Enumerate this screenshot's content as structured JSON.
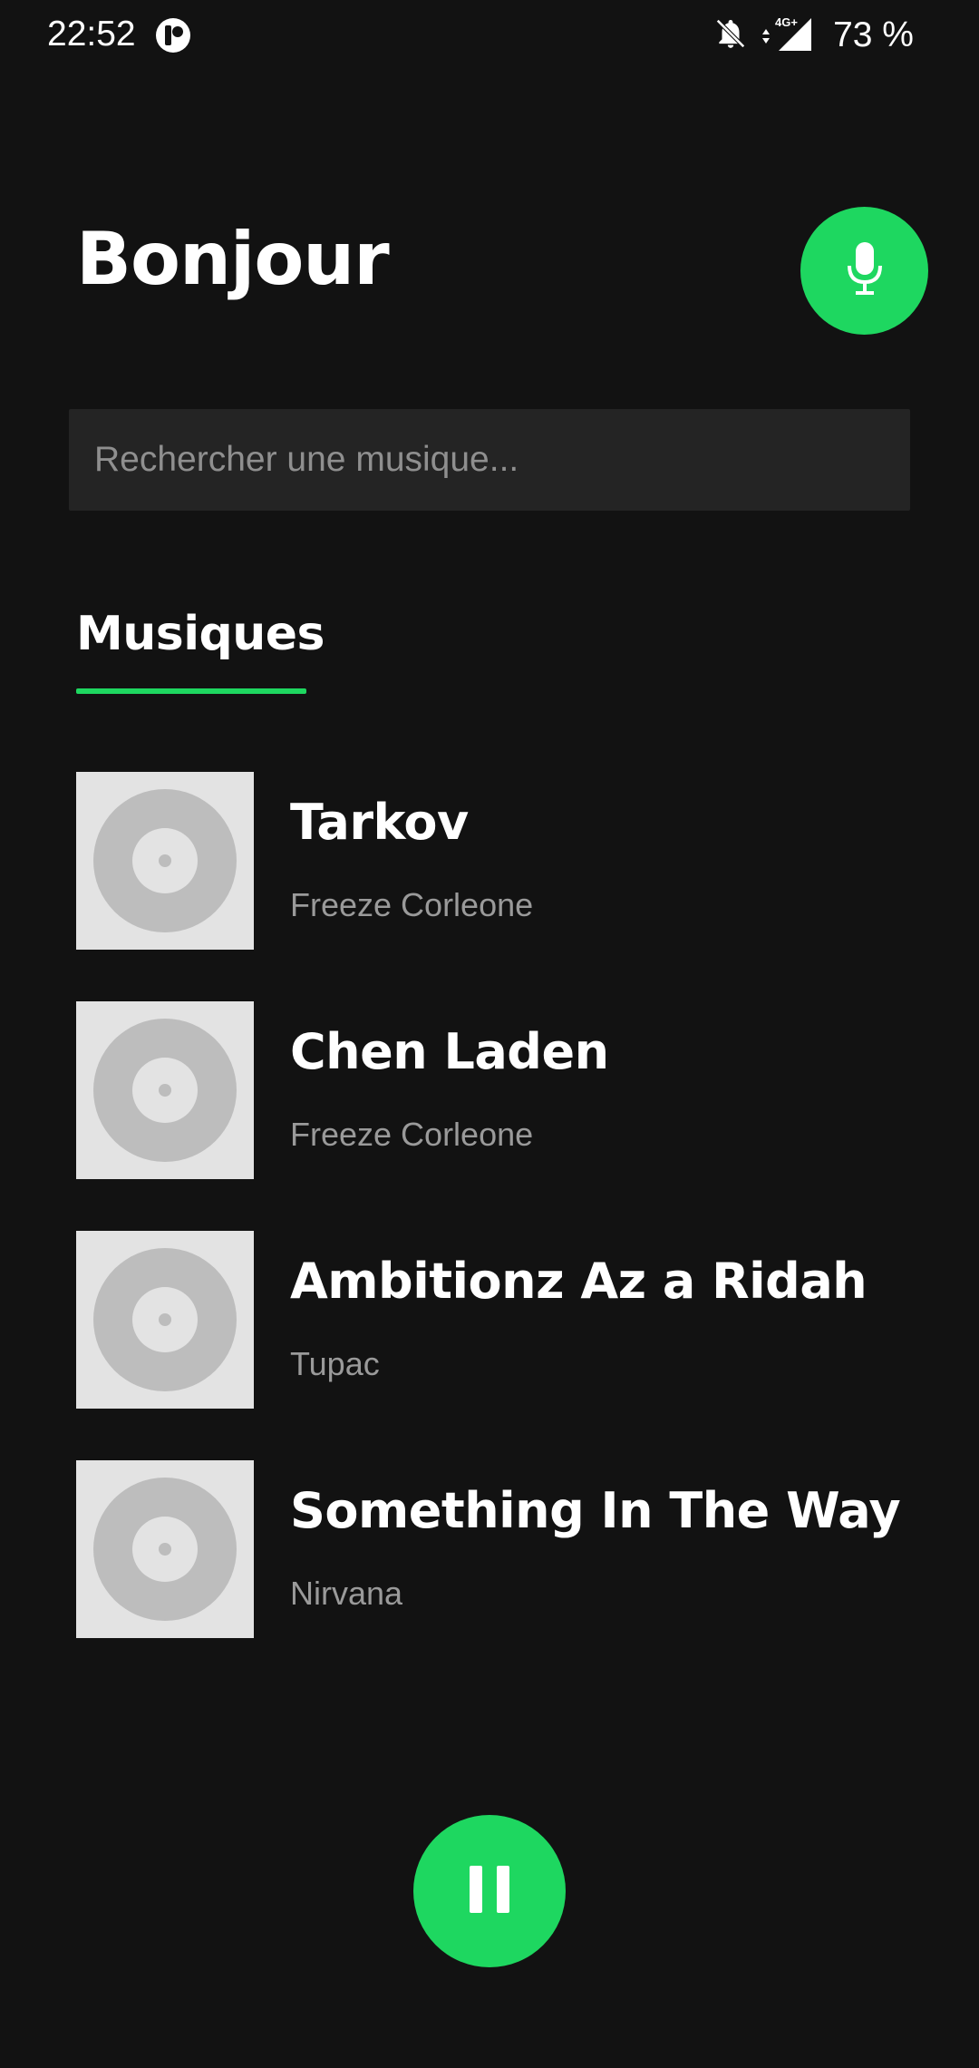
{
  "status_bar": {
    "time": "22:52",
    "battery": "73 %",
    "network": "4G+"
  },
  "header": {
    "greeting": "Bonjour",
    "mic_icon": "microphone-icon"
  },
  "search": {
    "placeholder": "Rechercher une musique...",
    "value": ""
  },
  "section": {
    "title": "Musiques"
  },
  "songs": [
    {
      "title": "Tarkov",
      "artist": "Freeze Corleone"
    },
    {
      "title": "Chen Laden",
      "artist": "Freeze Corleone"
    },
    {
      "title": "Ambitionz Az a Ridah",
      "artist": "Tupac"
    },
    {
      "title": "Something In The Way",
      "artist": "Nirvana"
    }
  ],
  "player": {
    "state_icon": "pause-icon"
  },
  "colors": {
    "background": "#121212",
    "accent": "#1ed760",
    "search_background": "#242424",
    "secondary_text": "#9a9a9a",
    "album_placeholder": "#e3e3e3"
  }
}
